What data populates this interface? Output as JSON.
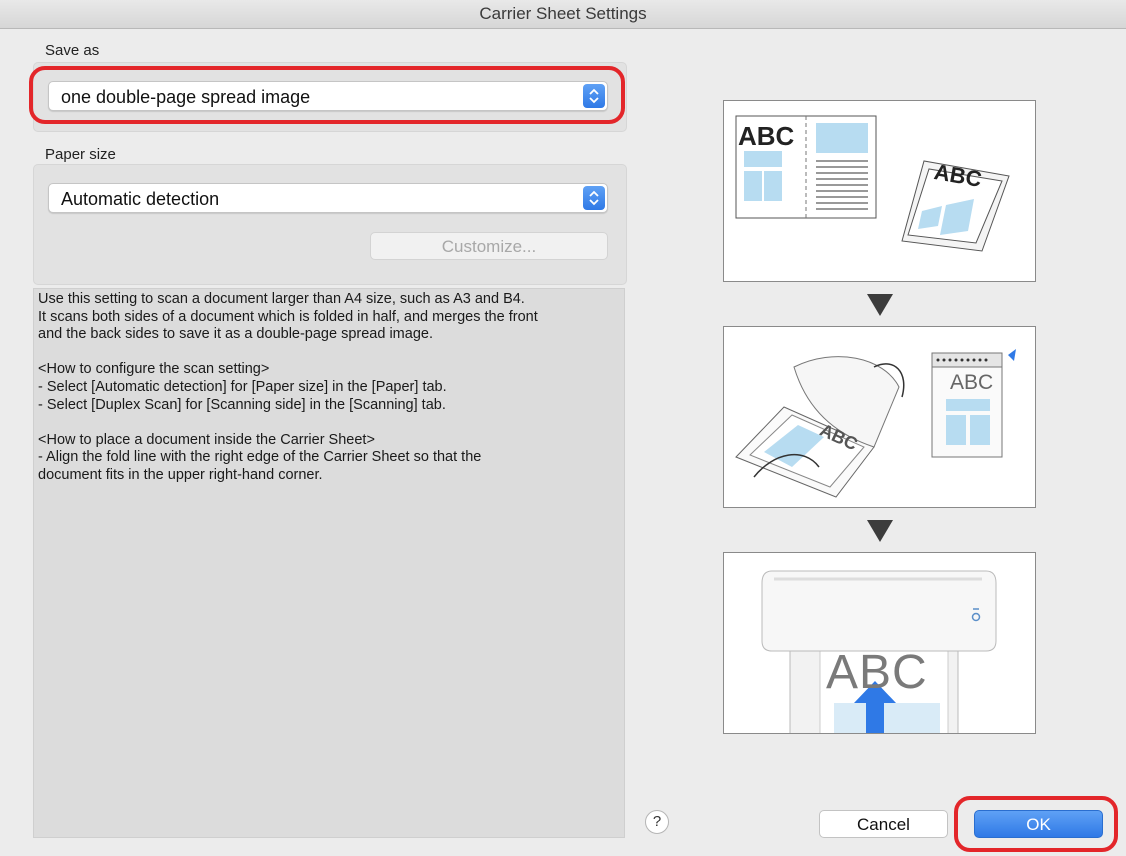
{
  "window": {
    "title": "Carrier Sheet Settings"
  },
  "save_as": {
    "label": "Save as",
    "selected": "one double-page spread image"
  },
  "paper_size": {
    "label": "Paper size",
    "selected": "Automatic detection",
    "customize_label": "Customize..."
  },
  "description": {
    "lines": [
      "Use this setting to scan a document larger than A4 size, such as A3 and B4.",
      "It scans both sides of a document which is folded in half, and merges the front",
      "and the back sides to save it as a double-page spread image.",
      "",
      "<How to configure the scan setting>",
      "- Select [Automatic detection] for [Paper size] in the [Paper] tab.",
      "- Select [Duplex Scan] for [Scanning side] in the [Scanning] tab.",
      "",
      "<How to place a document inside the Carrier Sheet>",
      "- Align the fold line with the right edge of the Carrier Sheet so that the",
      "document fits in the upper right-hand corner."
    ]
  },
  "illustrations": {
    "panel1_text_left": "ABC",
    "panel1_text_right": "ABC",
    "panel2_text_sheet": "ABC",
    "panel2_text_folded": "ABC",
    "panel3_text": "ABC"
  },
  "footer": {
    "help_label": "?",
    "cancel_label": "Cancel",
    "ok_label": "OK"
  },
  "colors": {
    "accent": "#2f79e6",
    "highlight_ring": "#e3262a",
    "illustration_blue": "#b7dcf1"
  }
}
